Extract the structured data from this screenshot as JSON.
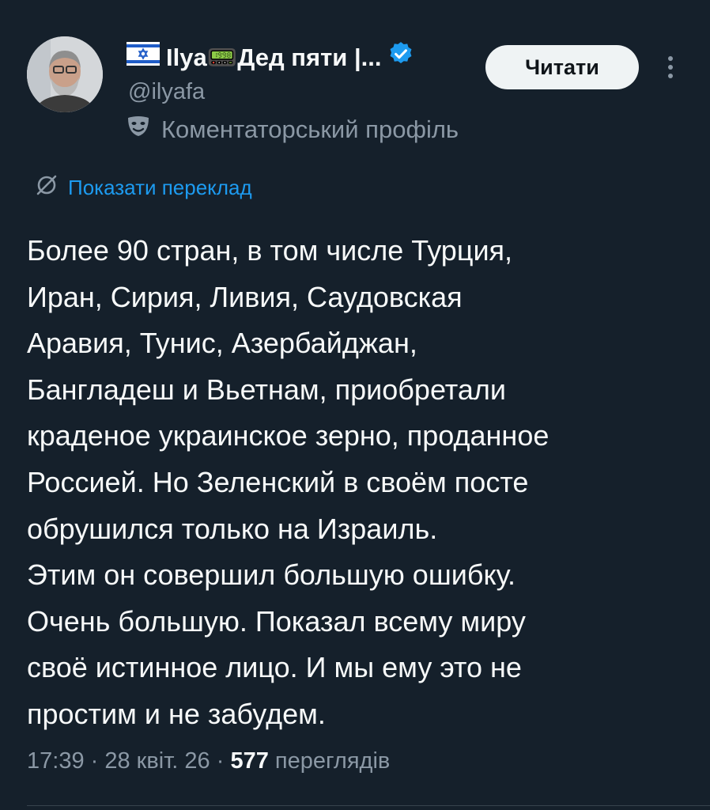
{
  "author": {
    "display_name": "Ilya📟Дед пяти |...",
    "handle": "@ilyafa",
    "profile_type": "Коментаторський профіль",
    "verified": true,
    "flag_icon": "israel-flag-icon",
    "badge_icon": "verified-badge-icon",
    "avatar_icon": "avatar-photo"
  },
  "actions": {
    "read_label": "Читати",
    "more_icon": "more-vertical-icon"
  },
  "translate": {
    "label": "Показати переклад",
    "icon": "translate-icon"
  },
  "tweet": {
    "text": "Более 90 стран, в том числе Турция,\nИран, Сирия, Ливия, Саудовская\nАравия, Тунис, Азербайджан,\nБангладеш и Вьетнам, приобретали\nкраденое украинское зерно, проданное\nРоссией. Но Зеленский в своём посте\nобрушился только на Израиль.\nЭтим он совершил большую ошибку.\nОчень большую. Показал всему миру\nсвоё истинное лицо. И мы ему это не\nпростим и не забудем."
  },
  "meta": {
    "time": "17:39",
    "sep1": " · ",
    "date": "28 квіт. 26",
    "sep2": " · ",
    "views_count": "577",
    "views_label": " переглядів"
  },
  "colors": {
    "background": "#15202b",
    "accent": "#1d9bf0",
    "secondary_text": "#8b98a5"
  }
}
